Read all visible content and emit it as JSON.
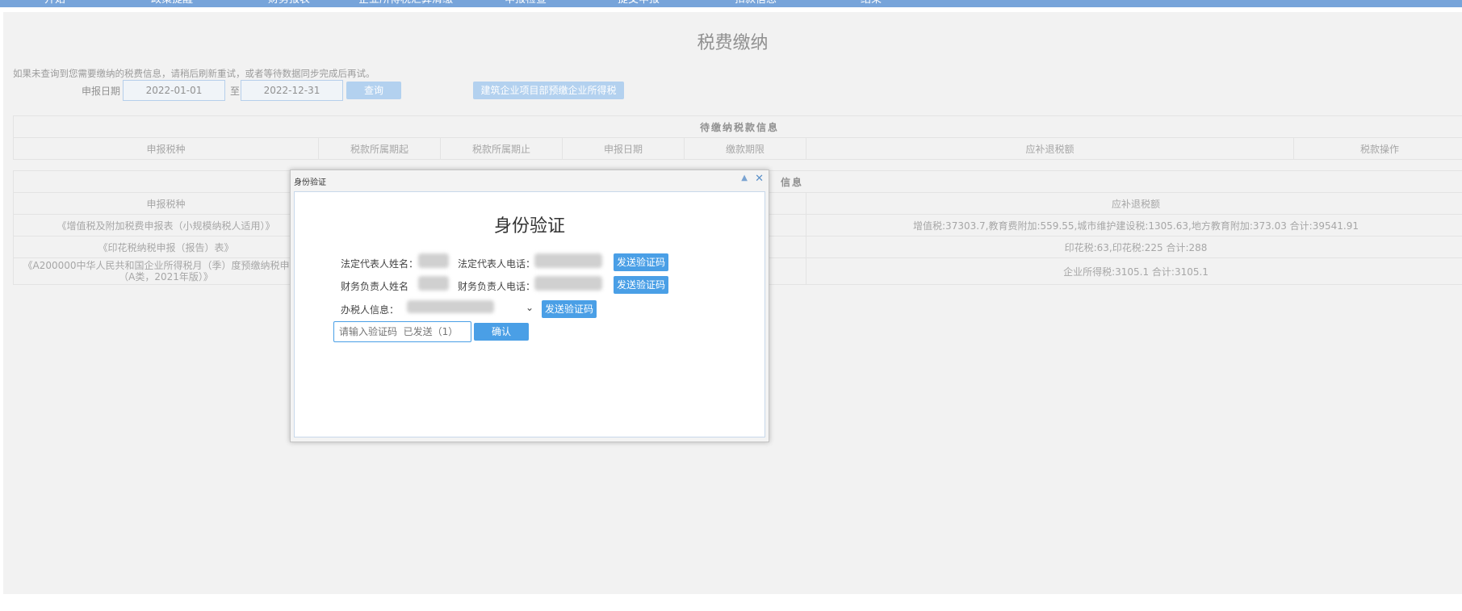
{
  "nav": [
    "开始",
    "政策提醒",
    "财务报表",
    "企业所得税汇算清缴",
    "申报检查",
    "提交申报",
    "扣款信息",
    "结束"
  ],
  "page": {
    "title": "税费缴纳",
    "notice": "如果未查询到您需要缴纳的税费信息，请稍后刷新重试，或者等待数据同步完成后再试。"
  },
  "search": {
    "date_label": "申报日期",
    "date_from": "2022-01-01",
    "to_label": "至",
    "date_to": "2022-12-31",
    "query_button": "查询",
    "prepay_button": "建筑企业项目部预缴企业所得税"
  },
  "pending_table": {
    "title": "待缴纳税款信息",
    "headers": [
      "申报税种",
      "税款所属期起",
      "税款所属期止",
      "申报日期",
      "缴款期限",
      "应补退税额",
      "税款操作"
    ]
  },
  "paid_table": {
    "title_fragment": "信息",
    "headers": [
      "申报税种",
      "应补退税额"
    ],
    "rows": [
      {
        "tax": "《增值税及附加税费申报表（小规模纳税人适用）》",
        "amount": "增值税:37303.7,教育费附加:559.55,城市维护建设税:1305.63,地方教育附加:373.03 合计:39541.91"
      },
      {
        "tax": "《印花税纳税申报（报告）表》",
        "amount": "印花税:63,印花税:225 合计:288"
      },
      {
        "tax": "《A200000中华人民共和国企业所得税月（季）度预缴纳税申报表（A类，2021年版）》",
        "amount": "企业所得税:3105.1 合计:3105.1"
      }
    ]
  },
  "dialog": {
    "window_title": "身份验证",
    "collapse_glyph": "▲",
    "close_glyph": "✕",
    "heading": "身份验证",
    "legal_name_label": "法定代表人姓名：",
    "legal_phone_label": "法定代表人电话：",
    "finance_name_label": "财务负责人姓名",
    "finance_phone_label": "财务负责人电话：",
    "handler_label": "办税人信息：",
    "send_code_button": "发送验证码",
    "code_placeholder": "请输入验证码  已发送（1）",
    "confirm_button": "确认"
  }
}
